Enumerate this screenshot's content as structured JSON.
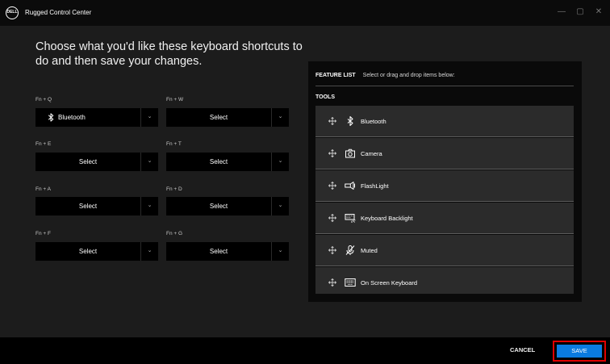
{
  "window": {
    "logo_text": "DELL",
    "title": "Rugged Control Center",
    "controls": {
      "minimize": "—",
      "maximize": "▢",
      "close": "✕"
    }
  },
  "heading": "Choose what you'd like these keyboard shortcuts to do and then save your changes.",
  "shortcuts": [
    {
      "key": "Fn + Q",
      "value": "Bluetooth",
      "icon": "bluetooth-icon"
    },
    {
      "key": "Fn + W",
      "value": "Select"
    },
    {
      "key": "Fn + E",
      "value": "Select"
    },
    {
      "key": "Fn + T",
      "value": "Select"
    },
    {
      "key": "Fn + A",
      "value": "Select"
    },
    {
      "key": "Fn + D",
      "value": "Select"
    },
    {
      "key": "Fn + F",
      "value": "Select"
    },
    {
      "key": "Fn + G",
      "value": "Select"
    }
  ],
  "feature_list": {
    "title": "FEATURE LIST",
    "instruction": "Select or drag and drop items below:",
    "section": "TOOLS",
    "items": [
      {
        "label": "Bluetooth",
        "icon": "bluetooth-icon"
      },
      {
        "label": "Camera",
        "icon": "camera-icon"
      },
      {
        "label": "FlashLight",
        "icon": "flashlight-icon"
      },
      {
        "label": "Keyboard Backlight",
        "icon": "keyboard-backlight-icon"
      },
      {
        "label": "Muted",
        "icon": "muted-icon"
      },
      {
        "label": "On Screen Keyboard",
        "icon": "on-screen-keyboard-icon"
      }
    ]
  },
  "footer": {
    "cancel": "CANCEL",
    "save": "SAVE"
  },
  "colors": {
    "accent": "#0a7be0",
    "highlight": "#e00000",
    "panel": "#0a0a0a",
    "background": "#1c1c1c"
  }
}
